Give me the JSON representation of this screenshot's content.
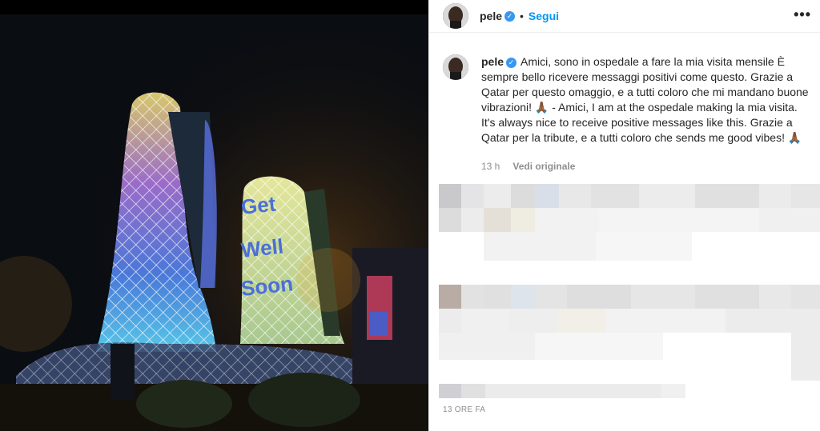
{
  "post": {
    "username": "pele",
    "follow_label": "Segui",
    "separator": "•",
    "more_label": "•••",
    "caption_username": "pele",
    "caption_text": "Amici, sono in ospedale a fare la mia visita mensile È sempre bello ricevere messaggi positivi come questo. Grazie a Qatar per questo omaggio, e a tutti coloro che mi mandano buone vibrazioni! 🙏🏾 - Amici, I am at the ospedale making la mia visita. It's always nice to receive positive messages like this. Grazie a Qatar per la tribute, e a tutti coloro che sends me good vibes! 🙏🏾",
    "caption_age": "13 h",
    "see_original_label": "Vedi originale",
    "timestamp": "13 ORE FA"
  },
  "photo": {
    "projection_text": "Get Well Soon"
  },
  "icons": {
    "verified": "verified-badge-icon",
    "more": "more-options-icon"
  },
  "colors": {
    "accent": "#0095f6",
    "verified": "#3897f0",
    "text": "#262626",
    "muted": "#8e8e8e"
  }
}
